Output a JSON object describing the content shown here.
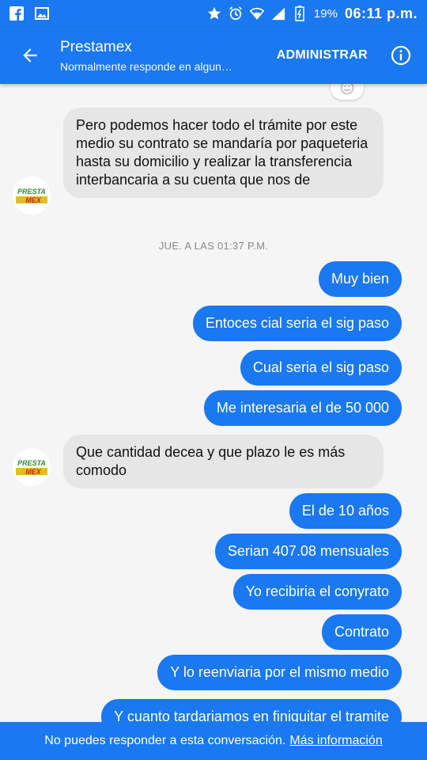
{
  "status_bar": {
    "icons_left": [
      "facebook-icon",
      "image-icon"
    ],
    "icons_right": [
      "star-icon",
      "alarm-icon",
      "wifi-icon",
      "signal-icon",
      "battery-icon"
    ],
    "battery": "19%",
    "time": "06:11 p.m."
  },
  "header": {
    "title": "Prestamex",
    "subtitle": "Normalmente responde en alguna…",
    "admin_label": "ADMINISTRAR"
  },
  "avatar": {
    "line1": "PRESTA",
    "line2": "MEX"
  },
  "messages": {
    "m1": "Pero podemos  hacer todo el trámite por este medio su contrato se mandaría por paqueteria hasta su domicilio y realizar la transferencia interbancaria a su cuenta que nos de",
    "timestamp": "JUE. A LAS 01:37 P.M.",
    "m2": "Muy bien",
    "m3": "Entoces cial seria el sig paso",
    "m4": "Cual seria el sig paso",
    "m5": "Me interesaria el de 50 000",
    "m6": "Que cantidad decea y que plazo le es más comodo",
    "m7": "El de 10 años",
    "m8": "Serian 407.08 mensuales",
    "m9": "Yo recibiria el conyrato",
    "m10": "Contrato",
    "m11": "Y lo reenviaria por el mismo medio",
    "m12": "Y cuanto tardariamos en finiquitar el tramite"
  },
  "footer": {
    "text": "No puedes responder a esta conversación.",
    "link": "Más información"
  },
  "colors": {
    "brand": "#1a78f0",
    "incoming_bubble": "#e6e6e6",
    "background": "#f5f5f5"
  }
}
